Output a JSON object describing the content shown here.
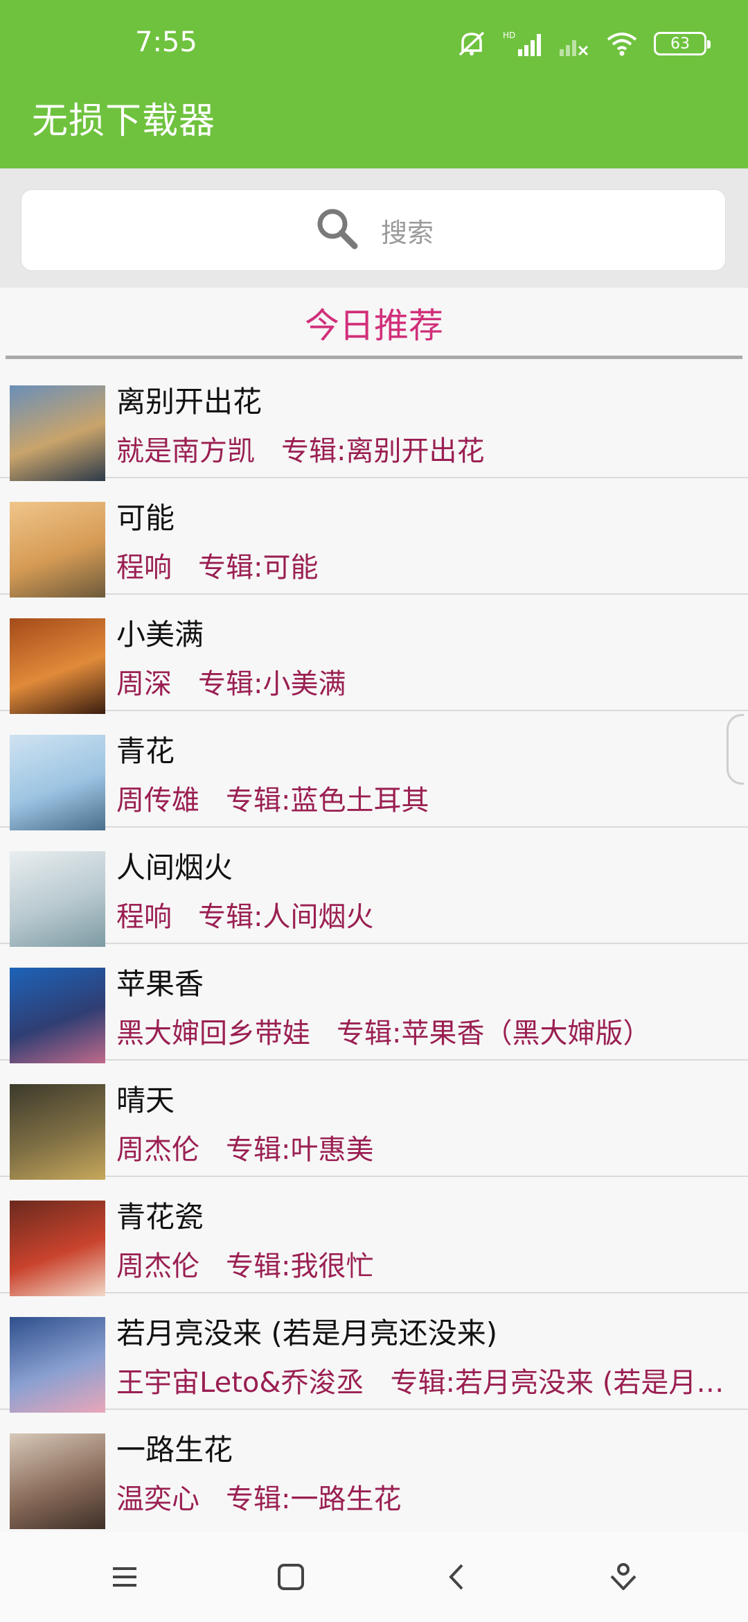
{
  "status": {
    "time": "7:55",
    "battery": "63"
  },
  "app": {
    "title": "无损下载器"
  },
  "search": {
    "placeholder": "搜索"
  },
  "section": {
    "title": "今日推荐"
  },
  "songs": [
    {
      "title": "离别开出花",
      "artist": "就是南方凯",
      "album": "专辑:离别开出花",
      "colors": [
        "#6a8fb8",
        "#c9a46b",
        "#2d3a4a"
      ]
    },
    {
      "title": "可能",
      "artist": "程响",
      "album": "专辑:可能",
      "colors": [
        "#f0c58a",
        "#d59b55",
        "#6d5a3b"
      ]
    },
    {
      "title": "小美满",
      "artist": "周深",
      "album": "专辑:小美满",
      "colors": [
        "#a54b1a",
        "#e08a3a",
        "#3a1e10"
      ]
    },
    {
      "title": "青花",
      "artist": "周传雄",
      "album": "专辑:蓝色土耳其",
      "colors": [
        "#cfe3f1",
        "#9cc4e2",
        "#4a6d8c"
      ]
    },
    {
      "title": "人间烟火",
      "artist": "程响",
      "album": "专辑:人间烟火",
      "colors": [
        "#e9eef0",
        "#b8c9cf",
        "#7d9aa3"
      ]
    },
    {
      "title": "苹果香",
      "artist": "黑大婶回乡带娃",
      "album": "专辑:苹果香（黑大婶版）",
      "colors": [
        "#1d63b8",
        "#2f3e73",
        "#c06a8a"
      ]
    },
    {
      "title": "晴天",
      "artist": "周杰伦",
      "album": "专辑:叶惠美",
      "colors": [
        "#3c3a2c",
        "#7f6f44",
        "#c7a85c"
      ]
    },
    {
      "title": "青花瓷",
      "artist": "周杰伦",
      "album": "专辑:我很忙",
      "colors": [
        "#6b2a1e",
        "#c9432d",
        "#f2d8c8"
      ]
    },
    {
      "title": "若月亮没来 (若是月亮还没来)",
      "artist": "王宇宙Leto&乔浚丞",
      "album": "专辑:若月亮没来 (若是月亮还没来)",
      "colors": [
        "#2e4f8c",
        "#8aa0d1",
        "#e9a6b8"
      ]
    },
    {
      "title": "一路生花",
      "artist": "温奕心",
      "album": "专辑:一路生花",
      "colors": [
        "#d7c8b9",
        "#8a6c5a",
        "#3e2f28"
      ]
    }
  ]
}
